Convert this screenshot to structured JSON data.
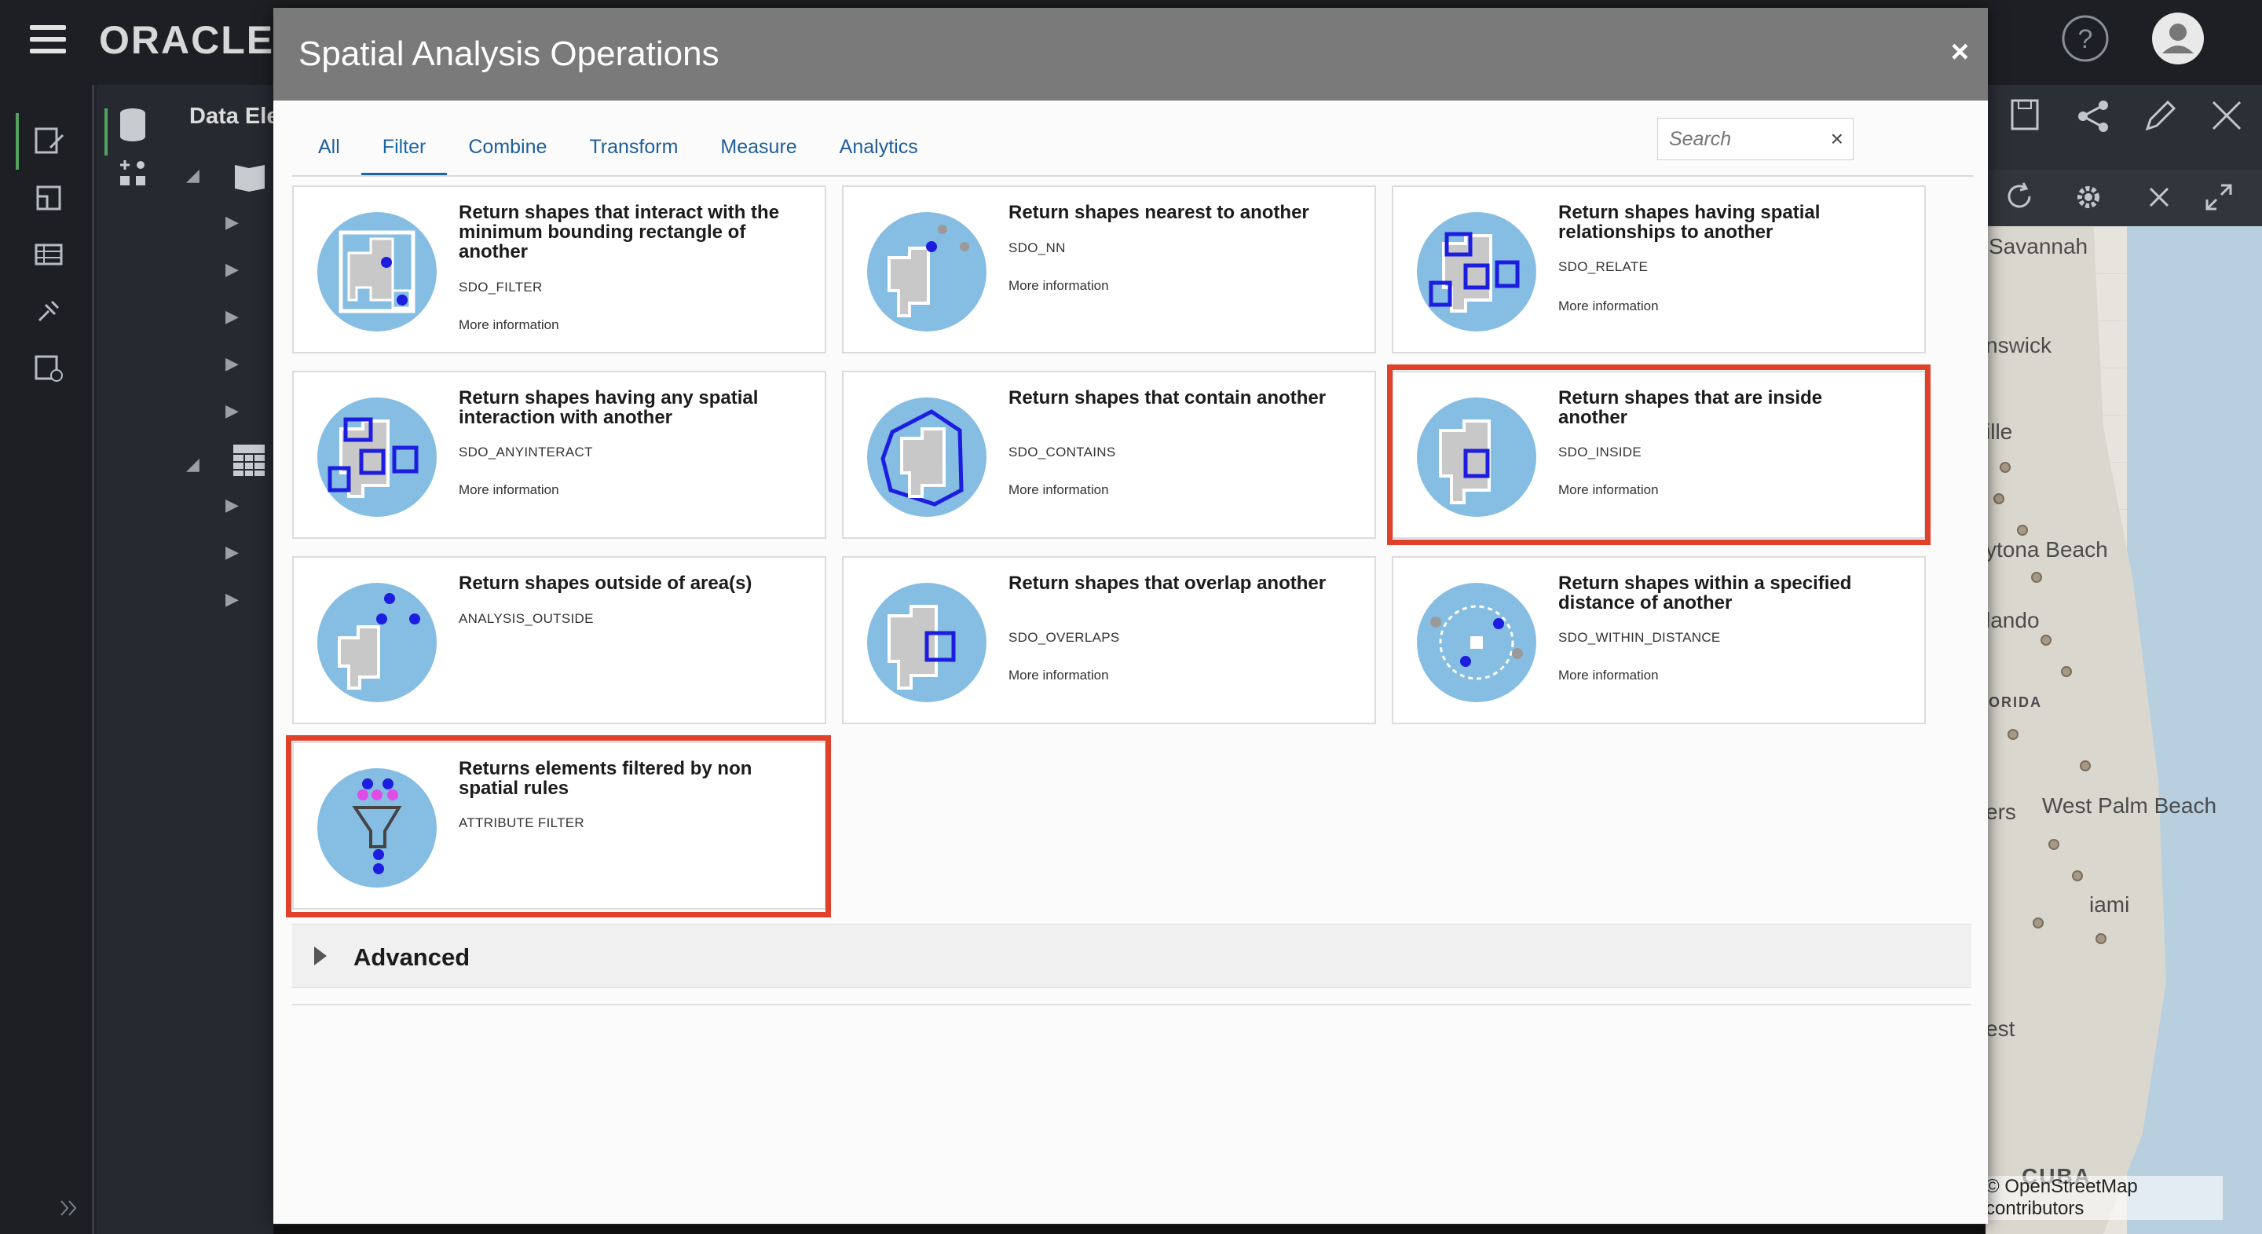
{
  "app": {
    "logo_text": "ORACLE"
  },
  "data_panel": {
    "title": "Data Ele"
  },
  "dialog": {
    "title": "Spatial Analysis Operations",
    "close_glyph": "×",
    "tabs": [
      {
        "label": "All",
        "active": false
      },
      {
        "label": "Filter",
        "active": true
      },
      {
        "label": "Combine",
        "active": false
      },
      {
        "label": "Transform",
        "active": false
      },
      {
        "label": "Measure",
        "active": false
      },
      {
        "label": "Analytics",
        "active": false
      }
    ],
    "search": {
      "placeholder": "Search",
      "clear_glyph": "×"
    },
    "cards": [
      {
        "title": "Return shapes that interact with the minimum bounding rectangle of another",
        "code": "SDO_FILTER",
        "more": "More information",
        "icon": "bounding-rectangle-icon",
        "highlighted": false
      },
      {
        "title": "Return shapes nearest to another",
        "code": "SDO_NN",
        "more": "More information",
        "icon": "nearest-neighbor-icon",
        "highlighted": false
      },
      {
        "title": "Return shapes having spatial relationships to another",
        "code": "SDO_RELATE",
        "more": "More information",
        "icon": "spatial-relate-icon",
        "highlighted": false
      },
      {
        "title": "Return shapes having any spatial interaction with another",
        "code": "SDO_ANYINTERACT",
        "more": "More information",
        "icon": "any-interact-icon",
        "highlighted": false
      },
      {
        "title": "Return shapes that contain another",
        "code": "SDO_CONTAINS",
        "more": "More information",
        "icon": "contains-icon",
        "highlighted": false
      },
      {
        "title": "Return shapes that are inside another",
        "code": "SDO_INSIDE",
        "more": "More information",
        "icon": "inside-icon",
        "highlighted": true
      },
      {
        "title": "Return shapes outside of area(s)",
        "code": "ANALYSIS_OUTSIDE",
        "more": "",
        "icon": "outside-icon",
        "highlighted": false
      },
      {
        "title": "Return shapes that overlap another",
        "code": "SDO_OVERLAPS",
        "more": "More information",
        "icon": "overlap-icon",
        "highlighted": false
      },
      {
        "title": "Return shapes within a specified distance of another",
        "code": "SDO_WITHIN_DISTANCE",
        "more": "More information",
        "icon": "within-distance-icon",
        "highlighted": false
      },
      {
        "title": "Returns elements filtered by non spatial rules",
        "code": "ATTRIBUTE FILTER",
        "more": "",
        "icon": "funnel-filter-icon",
        "highlighted": true
      }
    ],
    "advanced": {
      "label": "Advanced"
    }
  },
  "map": {
    "labels": [
      "Savannah",
      "nswick",
      "ille",
      "ytona Beach",
      "lando",
      "ORIDA",
      "ers",
      "West Palm Beach",
      "iami",
      "est",
      "CUBA"
    ],
    "attribution": "© OpenStreetMap contributors"
  },
  "colors": {
    "highlight": "#e0412a",
    "header": "#7a7a7a",
    "accent": "#1a66ad",
    "icon_bg": "#85bde3",
    "shape_gray": "#c8c8c8",
    "marker_blue": "#1d1de0"
  }
}
